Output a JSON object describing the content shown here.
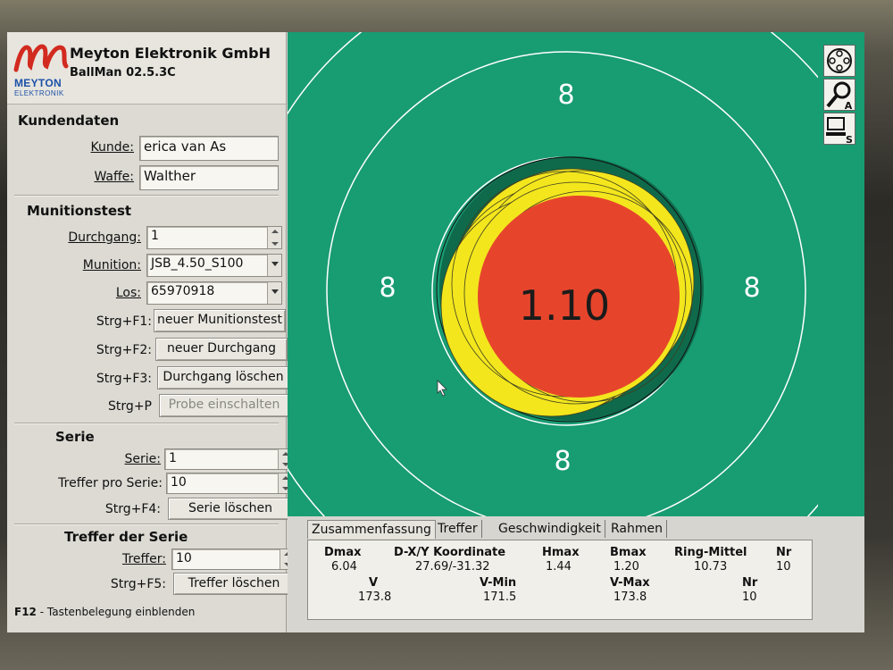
{
  "header": {
    "logo_word": "MEYTON",
    "logo_sub": "ELEKTRONIK",
    "company": "Meyton Elektronik GmbH",
    "version": "BallMan 02.5.3C"
  },
  "kundendaten": {
    "title": "Kundendaten",
    "kunde_label": "Kunde:",
    "kunde_value": "erica van As",
    "waffe_label": "Waffe:",
    "waffe_value": "Walther"
  },
  "munitionstest": {
    "title": "Munitionstest",
    "durchgang_label": "Durchgang:",
    "durchgang_value": "1",
    "munition_label": "Munition:",
    "munition_value": "JSB_4.50_S100",
    "los_label": "Los:",
    "los_value": "65970918",
    "shortcuts": [
      {
        "key": "Strg+F1:",
        "button": "neuer Munitionstest"
      },
      {
        "key": "Strg+F2:",
        "button": "neuer Durchgang"
      },
      {
        "key": "Strg+F3:",
        "button": "Durchgang löschen"
      },
      {
        "key": "Strg+P",
        "button": "Probe einschalten"
      }
    ]
  },
  "serie": {
    "title": "Serie",
    "serie_label": "Serie:",
    "serie_value": "1",
    "treffer_label": "Treffer pro Serie:",
    "treffer_value": "10",
    "shortcut_key": "Strg+F4:",
    "shortcut_button": "Serie löschen"
  },
  "treffer": {
    "title": "Treffer der Serie",
    "treffer_label": "Treffer:",
    "treffer_value": "10",
    "shortcut_key": "Strg+F5:",
    "shortcut_button": "Treffer löschen"
  },
  "footer": {
    "key": "F12",
    "text": " - Tastenbelegung einblenden"
  },
  "target": {
    "ring_label": "8",
    "center_value": "1.10",
    "colors": {
      "background": "#189c72",
      "hit_yellow": "#f3e61d",
      "center_red": "#e6452c",
      "ring_white": "#ffffff"
    }
  },
  "tools": {
    "icons": [
      "target-settings-icon",
      "zoom-a-icon",
      "computer-s-icon"
    ],
    "zoom_letter": "A",
    "computer_letter": "S"
  },
  "tabs": [
    "Zusammenfassung",
    "Treffer",
    "Geschwindigkeit",
    "Rahmen"
  ],
  "stats": {
    "row1_headers": [
      "Dmax",
      "D-X/Y Koordinate",
      "Hmax",
      "Bmax",
      "Ring-Mittel",
      "Nr"
    ],
    "row1_values": [
      "6.04",
      "27.69/-31.32",
      "1.44",
      "1.20",
      "10.73",
      "10"
    ],
    "row2_headers": [
      "V",
      "V-Min",
      "V-Max",
      "Nr"
    ],
    "row2_values": [
      "173.8",
      "171.5",
      "173.8",
      "10"
    ]
  }
}
